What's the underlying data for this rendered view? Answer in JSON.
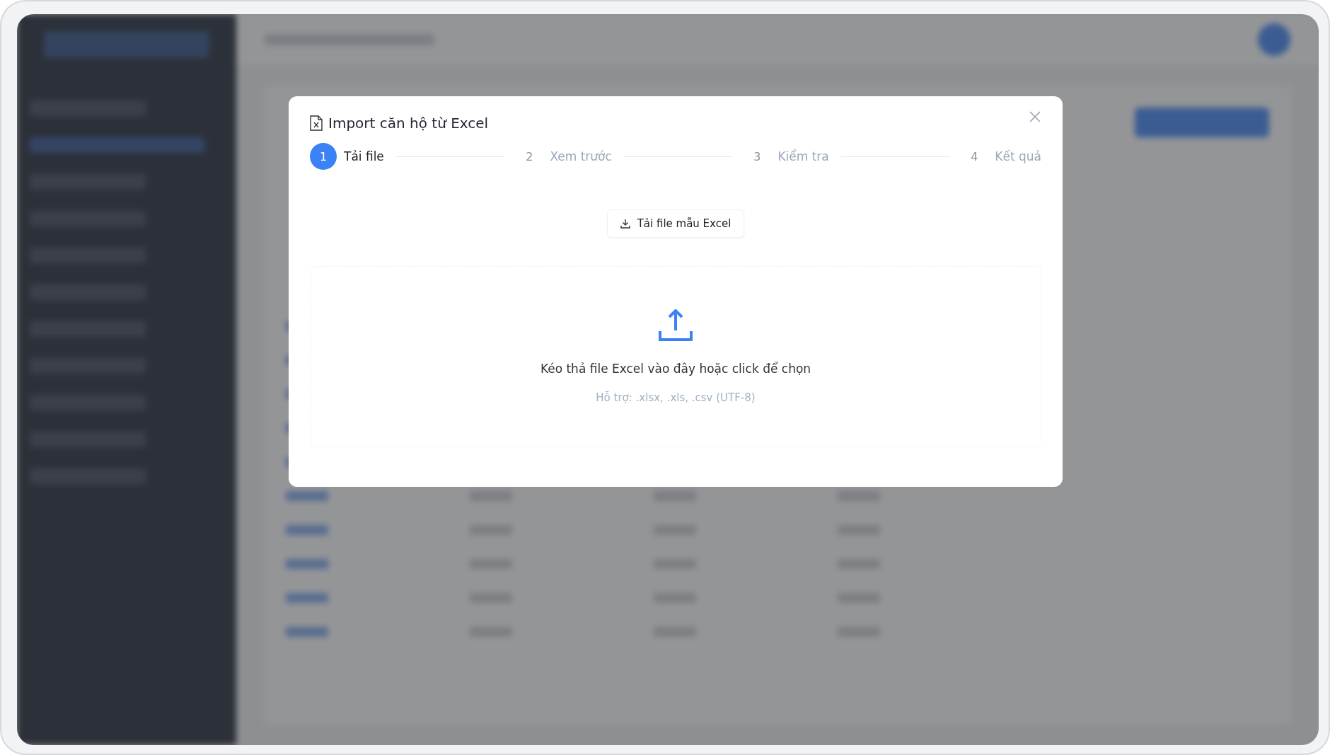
{
  "modal": {
    "title": "Import căn hộ từ Excel",
    "steps": [
      {
        "number": "1",
        "label": "Tải file",
        "selected": true
      },
      {
        "number": "2",
        "label": "Xem trước",
        "selected": false
      },
      {
        "number": "3",
        "label": "Kiểm tra",
        "selected": false
      },
      {
        "number": "4",
        "label": "Kết quả",
        "selected": false
      }
    ],
    "template_button": "Tải file mẫu Excel",
    "dropzone": {
      "text": "Kéo thả file Excel vào đây hoặc click để chọn",
      "hint": "Hỗ trợ: .xlsx, .xls, .csv (UTF-8)"
    }
  }
}
